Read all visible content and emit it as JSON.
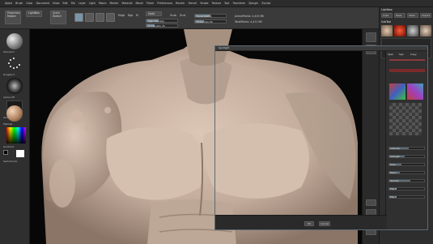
{
  "menu": [
    "Alpha",
    "Brush",
    "Color",
    "Document",
    "Draw",
    "Edit",
    "File",
    "Layer",
    "Light",
    "Macro",
    "Marker",
    "Material",
    "Movie",
    "Picker",
    "Preferences",
    "Render",
    "Stencil",
    "Stroke",
    "Texture",
    "Tool",
    "Transform",
    "Zplugin",
    "Zscript"
  ],
  "toolbar": {
    "projection_master": "Projection Master",
    "lightbox": "LightBox",
    "quick_sketch": "Quick Sketch",
    "edit": "Edit",
    "draw": "Draw",
    "move": "Move",
    "scale": "Scale",
    "rotate": "Rotate",
    "mrgb": "Mrgb",
    "rgb": "Rgb",
    "m": "M",
    "zadd": "Zadd",
    "zsub": "Zsub",
    "zcut": "Zcut",
    "rgb_intensity": "Rgb Intensity",
    "z_intensity": "Z Intensity 25",
    "focal_shift": "Focal Shift 0",
    "draw_size": "Draw Size 64",
    "active_points": "ActivePoints: 4,403 Mil",
    "total_points": "TotalPoints: 4,411 Mil"
  },
  "left_shelf": {
    "brush_label": "Standard",
    "stroke_label": "DragRect",
    "alpha_label": "Alpha Off",
    "texture_label": "Texture Off",
    "material_label": "MatCap",
    "gradient_label": "Gradient",
    "switch_color": "SwitchColor"
  },
  "right_panel": {
    "header": "Lightbox",
    "subtools": "SubTool",
    "tabs": [
      "Spec",
      "Spe",
      "Copy",
      "Paste"
    ],
    "slider_labels": [
      "Intensity",
      "Strength",
      "Fade",
      "Blend",
      "Opacity",
      "Flip H",
      "Flip V"
    ],
    "buttons": [
      "Load",
      "Save",
      "Clear",
      "Import",
      "Export"
    ]
  },
  "dialog": {
    "title": "Spotlight",
    "ok": "OK",
    "cancel": "Cancel",
    "side_tabs": [
      "Spec",
      "Spe",
      "Copy"
    ]
  },
  "colors": {
    "ui_dark": "#2e2e2e",
    "skin": "#cdb7a7",
    "accent": "#7b95a8"
  }
}
